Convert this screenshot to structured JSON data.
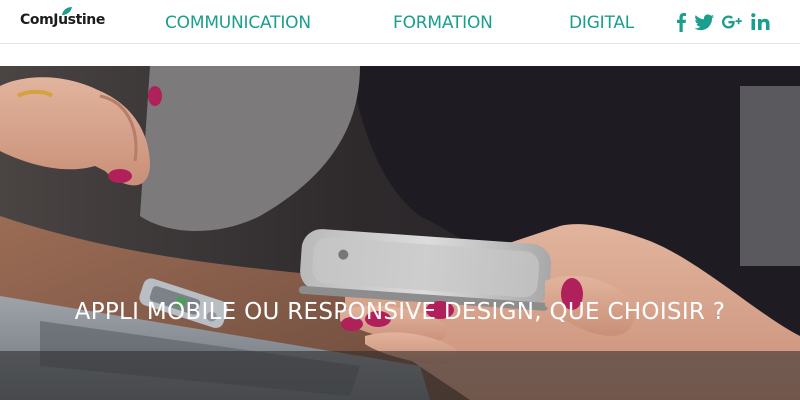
{
  "header": {
    "logo": {
      "text": "ComJustine",
      "icon": "leaf-icon",
      "leaf_color": "#1a9e8e"
    },
    "nav": [
      {
        "label": "COMMUNICATION"
      },
      {
        "label": "FORMATION"
      },
      {
        "label": "DIGITAL"
      }
    ],
    "social": [
      {
        "icon": "facebook-icon"
      },
      {
        "icon": "twitter-icon"
      },
      {
        "icon": "google-plus-icon"
      },
      {
        "icon": "linkedin-icon"
      }
    ],
    "accent_color": "#1a9e8e"
  },
  "hero": {
    "image": "hands-holding-smartphone-photo",
    "caption": "APPLI MOBILE OU RESPONSIVE DESIGN, QUE CHOISIR ?"
  }
}
